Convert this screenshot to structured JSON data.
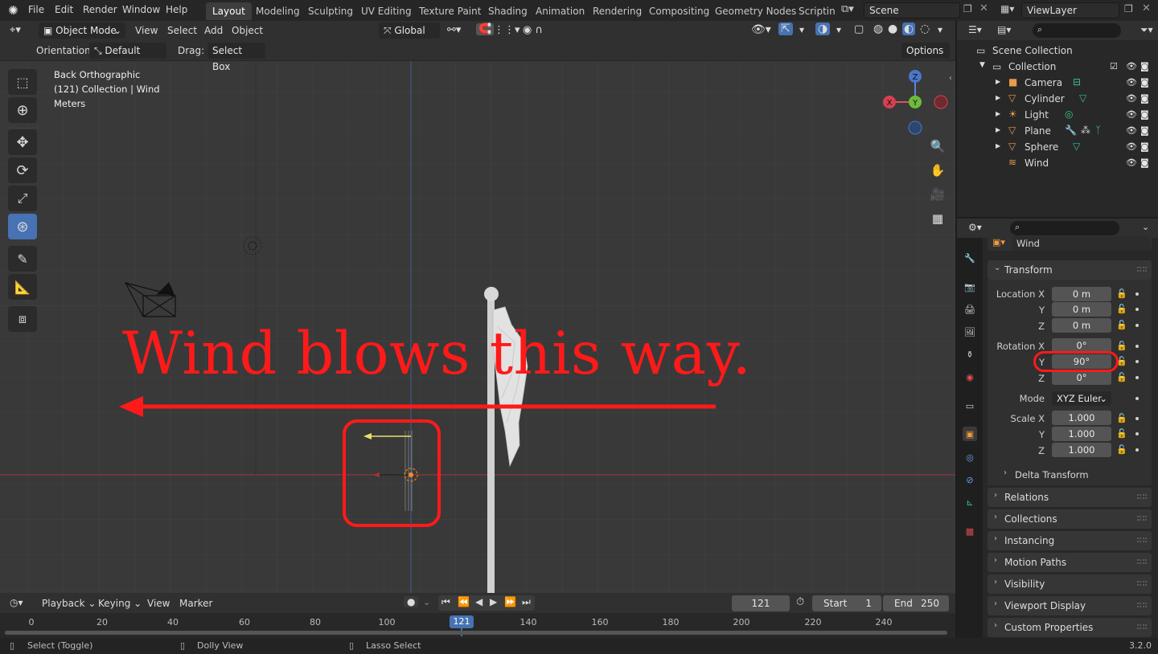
{
  "menubar": {
    "items": [
      "File",
      "Edit",
      "Render",
      "Window",
      "Help"
    ],
    "workspaces": [
      "Layout",
      "Modeling",
      "Sculpting",
      "UV Editing",
      "Texture Paint",
      "Shading",
      "Animation",
      "Rendering",
      "Compositing",
      "Geometry Nodes",
      "Scripting"
    ],
    "active_workspace": "Layout",
    "scene": "Scene",
    "view_layer": "ViewLayer"
  },
  "viewport": {
    "mode": "Object Mode",
    "menus": [
      "View",
      "Select",
      "Add",
      "Object"
    ],
    "transform_orientation": "Global",
    "orientation_label": "Orientation:",
    "orientation_value": "Default",
    "drag_label": "Drag:",
    "drag_value": "Select Box",
    "options": "Options",
    "overlay": [
      "Back Orthographic",
      "(121) Collection | Wind",
      "Meters"
    ],
    "gizmo": {
      "z": "Z",
      "y": "Y",
      "x": "X"
    },
    "annotation": "Wind blows this way."
  },
  "outliner": {
    "root": "Scene Collection",
    "collection": "Collection",
    "objects": [
      "Camera",
      "Cylinder",
      "Light",
      "Plane",
      "Sphere",
      "Wind"
    ]
  },
  "properties": {
    "object_name": "Wind",
    "transform_title": "Transform",
    "location_label": "Location X",
    "location": [
      "0 m",
      "0 m",
      "0 m"
    ],
    "rotation_label": "Rotation X",
    "rotation": [
      "0°",
      "90°",
      "0°"
    ],
    "mode_label": "Mode",
    "mode_value": "XYZ Euler",
    "scale_label": "Scale X",
    "scale": [
      "1.000",
      "1.000",
      "1.000"
    ],
    "axis_y": "Y",
    "axis_z": "Z",
    "delta": "Delta Transform",
    "panels": [
      "Relations",
      "Collections",
      "Instancing",
      "Motion Paths",
      "Visibility",
      "Viewport Display",
      "Custom Properties"
    ]
  },
  "timeline": {
    "menus": [
      "Playback",
      "Keying",
      "View",
      "Marker"
    ],
    "current_frame": "121",
    "start_label": "Start",
    "start": "1",
    "end_label": "End",
    "end": "250",
    "ticks": [
      "0",
      "20",
      "40",
      "60",
      "80",
      "100",
      "140",
      "160",
      "180",
      "200",
      "220",
      "240"
    ]
  },
  "status": {
    "select": "Select (Toggle)",
    "dolly": "Dolly View",
    "lasso": "Lasso Select",
    "version": "3.2.0"
  },
  "colors": {
    "accent": "#4772b3",
    "annotation": "#ff1a1a",
    "viewport_bg": "#393939"
  }
}
